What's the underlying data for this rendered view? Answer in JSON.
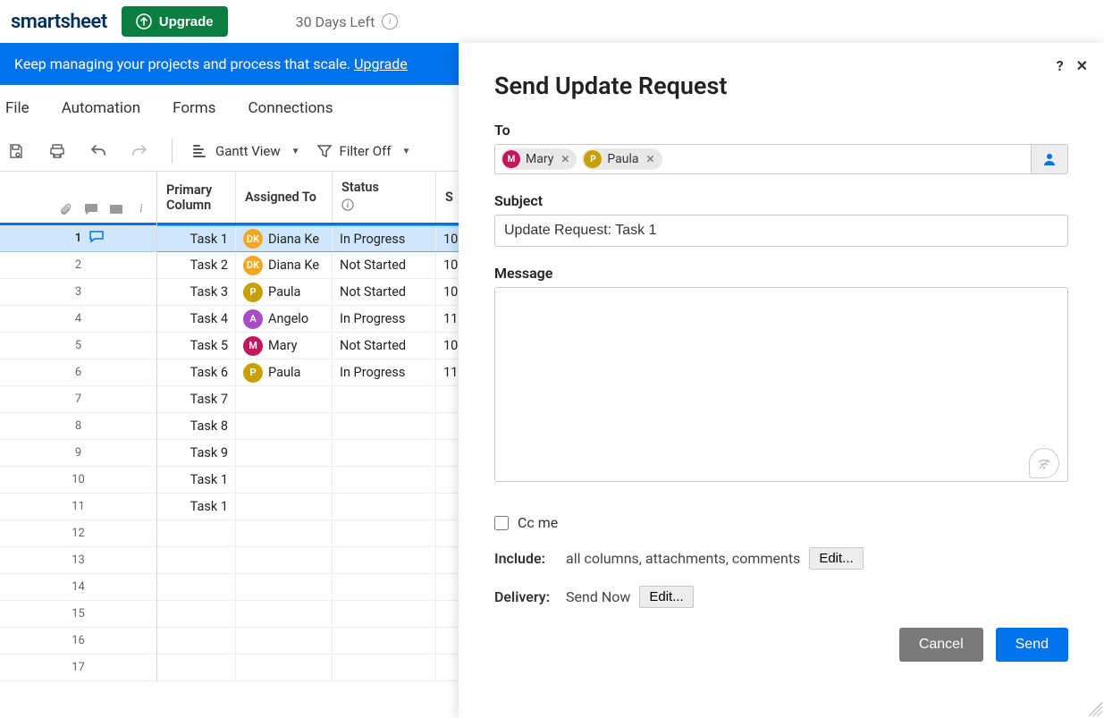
{
  "topbar": {
    "brand": "smartsheet",
    "upgrade": "Upgrade",
    "trial": "30 Days Left"
  },
  "banner": {
    "text": "Keep managing your projects and process that scale. ",
    "link": "Upgrade"
  },
  "menu": [
    "File",
    "Automation",
    "Forms",
    "Connections"
  ],
  "toolbar": {
    "view": "Gantt View",
    "filter": "Filter Off"
  },
  "columns": {
    "primary": "Primary Column",
    "assigned": "Assigned To",
    "status": "Status",
    "s": "S"
  },
  "colors": {
    "dk": "#f5a623",
    "p": "#c7a100",
    "a": "#a84dc6",
    "m": "#c2185b"
  },
  "rows": [
    {
      "num": "1",
      "task": "Task 1",
      "initials": "DK",
      "colorKey": "dk",
      "assignee": "Diana Ke",
      "status": "In Progress",
      "s": "10",
      "selected": true,
      "hasComment": true
    },
    {
      "num": "2",
      "task": "Task 2",
      "initials": "DK",
      "colorKey": "dk",
      "assignee": "Diana Ke",
      "status": "Not Started",
      "s": "10"
    },
    {
      "num": "3",
      "task": "Task 3",
      "initials": "P",
      "colorKey": "p",
      "assignee": "Paula",
      "status": "Not Started",
      "s": "10"
    },
    {
      "num": "4",
      "task": "Task 4",
      "initials": "A",
      "colorKey": "a",
      "assignee": "Angelo",
      "status": "In Progress",
      "s": "11"
    },
    {
      "num": "5",
      "task": "Task 5",
      "initials": "M",
      "colorKey": "m",
      "assignee": "Mary",
      "status": "Not Started",
      "s": "10"
    },
    {
      "num": "6",
      "task": "Task 6",
      "initials": "P",
      "colorKey": "p",
      "assignee": "Paula",
      "status": "In Progress",
      "s": "11"
    },
    {
      "num": "7",
      "task": "Task 7"
    },
    {
      "num": "8",
      "task": "Task 8"
    },
    {
      "num": "9",
      "task": "Task 9"
    },
    {
      "num": "10",
      "task": "Task 1"
    },
    {
      "num": "11",
      "task": "Task 1"
    },
    {
      "num": "12",
      "task": ""
    },
    {
      "num": "13",
      "task": ""
    },
    {
      "num": "14",
      "task": ""
    },
    {
      "num": "15",
      "task": ""
    },
    {
      "num": "16",
      "task": ""
    },
    {
      "num": "17",
      "task": ""
    }
  ],
  "panel": {
    "title": "Send Update Request",
    "to_label": "To",
    "recipients": [
      {
        "initials": "M",
        "colorKey": "m",
        "name": "Mary"
      },
      {
        "initials": "P",
        "colorKey": "p",
        "name": "Paula"
      }
    ],
    "subject_label": "Subject",
    "subject_value": "Update Request: Task 1",
    "message_label": "Message",
    "message_value": "",
    "cc_label": "Cc me",
    "include_label": "Include:",
    "include_value": "all columns, attachments, comments",
    "delivery_label": "Delivery:",
    "delivery_value": "Send Now",
    "edit": "Edit...",
    "cancel": "Cancel",
    "send": "Send"
  }
}
